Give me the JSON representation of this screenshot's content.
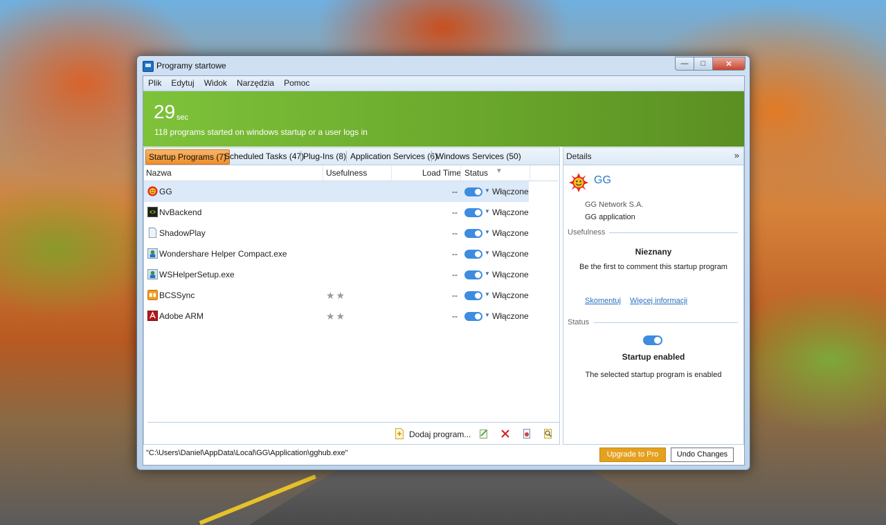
{
  "window": {
    "title": "Programy startowe",
    "minimize_glyph": "—",
    "maximize_glyph": "□",
    "close_glyph": "✕"
  },
  "menu": [
    "Plik",
    "Edytuj",
    "Widok",
    "Narzędzia",
    "Pomoc"
  ],
  "banner": {
    "value": "29",
    "unit": "sec",
    "description": "118 programs started on windows startup or a user logs in"
  },
  "tabs": [
    "Startup Programs (7)",
    "Scheduled Tasks (47)",
    "Plug-Ins (8)",
    "Application Services (6)",
    "Windows Services (50)"
  ],
  "columns": {
    "name": "Nazwa",
    "usefulness": "Usefulness",
    "load_time": "Load Time",
    "status": "Status"
  },
  "rows": [
    {
      "name": "GG",
      "icon": "gg-sun-icon",
      "stars": "",
      "load_time": "--",
      "status": "Włączone"
    },
    {
      "name": "NvBackend",
      "icon": "nvidia-icon",
      "stars": "",
      "load_time": "--",
      "status": "Włączone"
    },
    {
      "name": "ShadowPlay",
      "icon": "document-icon",
      "stars": "",
      "load_time": "--",
      "status": "Włączone"
    },
    {
      "name": "Wondershare Helper Compact.exe",
      "icon": "wondershare-icon",
      "stars": "",
      "load_time": "--",
      "status": "Włączone"
    },
    {
      "name": "WSHelperSetup.exe",
      "icon": "wondershare-icon",
      "stars": "",
      "load_time": "--",
      "status": "Włączone"
    },
    {
      "name": "BCSSync",
      "icon": "bcssync-icon",
      "stars": "★★",
      "load_time": "--",
      "status": "Włączone"
    },
    {
      "name": "Adobe ARM",
      "icon": "adobe-icon",
      "stars": "★★",
      "load_time": "--",
      "status": "Włączone"
    }
  ],
  "toolbar": {
    "add_label": "Dodaj program..."
  },
  "details": {
    "header": "Details",
    "expand_glyph": "»",
    "name": "GG",
    "publisher": "GG Network S.A.",
    "description": "GG application",
    "usefulness_section": "Usefulness",
    "usefulness_value": "Nieznany",
    "usefulness_text": "Be the first to comment this startup program",
    "comment_link": "Skomentuj",
    "more_info_link": "Więcej informacji",
    "status_section": "Status",
    "status_title": "Startup enabled",
    "status_text": "The selected startup program is enabled"
  },
  "footer": {
    "path": "\"C:\\Users\\Daniel\\AppData\\Local\\GG\\Application\\gghub.exe\"",
    "upgrade_label": "Upgrade to Pro",
    "undo_label": "Undo Changes"
  },
  "colors": {
    "accent_green": "#7ec23a",
    "tab_active": "#ef8f2c",
    "toggle_on": "#3d8ce0",
    "upgrade_button": "#e4a11f",
    "link": "#2a6fc0"
  }
}
